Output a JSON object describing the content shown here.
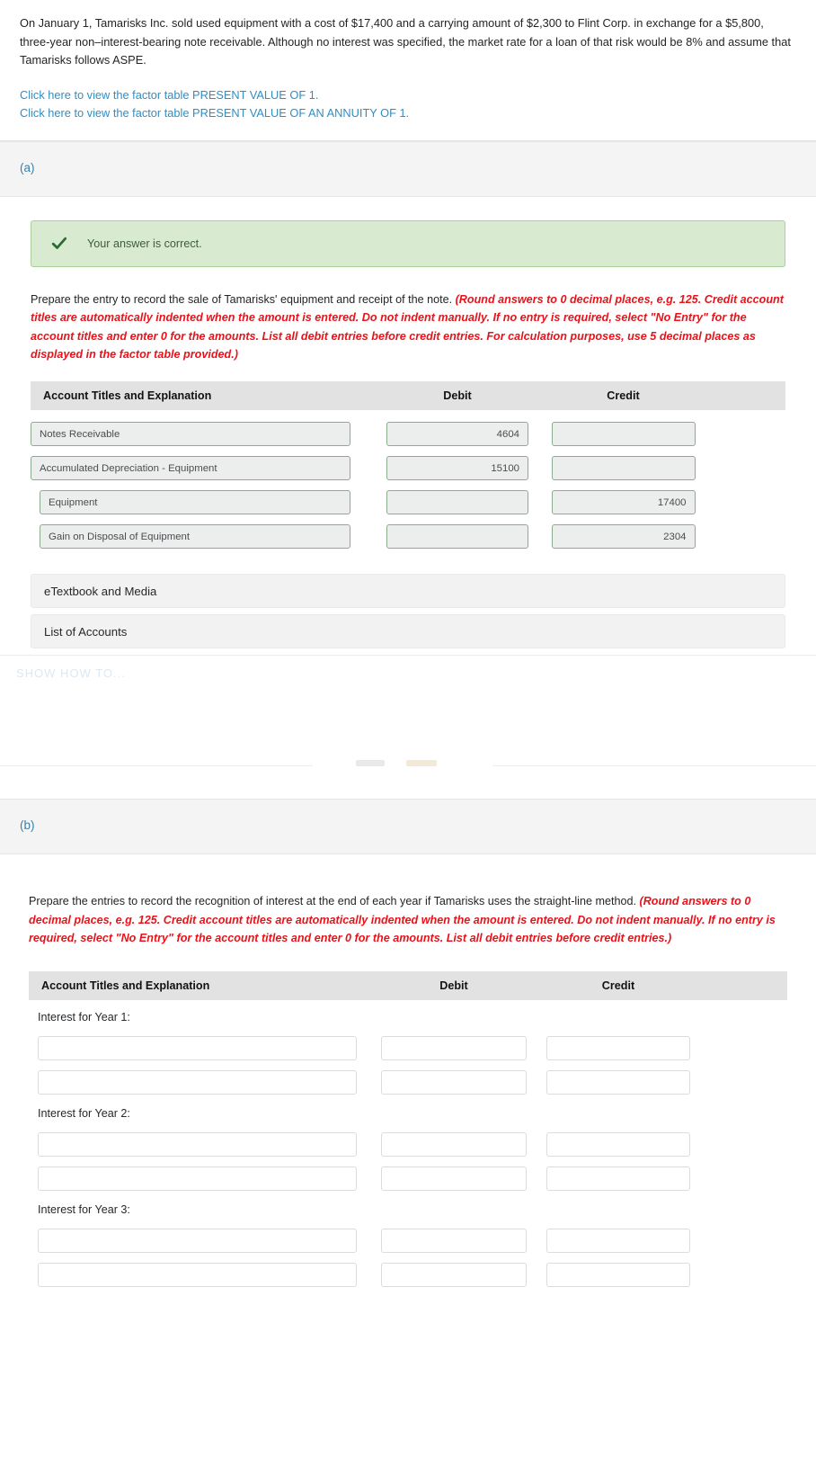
{
  "problem": {
    "statement": "On January 1, Tamarisks Inc. sold used equipment with a cost of $17,400 and a carrying amount of $2,300 to Flint Corp. in exchange for a $5,800, three-year non–interest-bearing note receivable. Although no interest was specified, the market rate for a loan of that risk would be 8% and assume that Tamarisks follows ASPE.",
    "links": [
      "Click here to view the factor table PRESENT VALUE OF 1.",
      "Click here to view the factor table PRESENT VALUE OF AN ANNUITY OF 1."
    ]
  },
  "colors": {
    "link": "#2f8ec4",
    "part_label": "#3a7fa8",
    "alert_bg": "#d8ebd0",
    "alert_border": "#a9cf9b",
    "alert_check": "#2b6b33",
    "instruction_emphasis": "#e8131a",
    "table_header_bg": "#e2e2e2",
    "answered_input_border": "#8aad8d",
    "answered_input_bg": "#eceded"
  },
  "part_a": {
    "label": "(a)",
    "alert": {
      "icon": "check-icon",
      "text": "Your answer is correct."
    },
    "instruction_plain": "Prepare the entry to record the sale of Tamarisks' equipment and receipt of the note. ",
    "instruction_emphasis": "(Round answers to 0 decimal places, e.g. 125. Credit account titles are automatically indented when the amount is entered. Do not indent manually. If no entry is required, select \"No Entry\" for the account titles and enter 0 for the amounts. List all debit entries before credit entries. For calculation purposes, use 5 decimal places as displayed in the factor table provided.)",
    "table": {
      "headers": {
        "account": "Account Titles and Explanation",
        "debit": "Debit",
        "credit": "Credit"
      },
      "rows": [
        {
          "account": "Notes Receivable",
          "debit": "4604",
          "credit": "",
          "indent": false
        },
        {
          "account": "Accumulated Depreciation - Equipment",
          "debit": "15100",
          "credit": "",
          "indent": false
        },
        {
          "account": "Equipment",
          "debit": "",
          "credit": "17400",
          "indent": true
        },
        {
          "account": "Gain on Disposal of Equipment",
          "debit": "",
          "credit": "2304",
          "indent": true
        }
      ]
    },
    "panels": [
      "eTextbook and Media",
      "List of Accounts"
    ]
  },
  "gap": {
    "ghost_text": "SHOW HOW TO..."
  },
  "part_b": {
    "label": "(b)",
    "instruction_plain": "Prepare the entries to record the recognition of interest at the end of each year if Tamarisks uses the straight-line method. ",
    "instruction_emphasis": "(Round answers to 0 decimal places, e.g. 125. Credit account titles are automatically indented when the amount is entered. Do not indent manually. If no entry is required, select \"No Entry\" for the account titles and enter 0 for the amounts. List all debit entries before credit entries.)",
    "table": {
      "headers": {
        "account": "Account Titles and Explanation",
        "debit": "Debit",
        "credit": "Credit"
      },
      "groups": [
        {
          "label": "Interest for Year 1:",
          "rows": [
            {
              "account": "",
              "debit": "",
              "credit": ""
            },
            {
              "account": "",
              "debit": "",
              "credit": ""
            }
          ]
        },
        {
          "label": "Interest for Year 2:",
          "rows": [
            {
              "account": "",
              "debit": "",
              "credit": ""
            },
            {
              "account": "",
              "debit": "",
              "credit": ""
            }
          ]
        },
        {
          "label": "Interest for Year 3:",
          "rows": [
            {
              "account": "",
              "debit": "",
              "credit": ""
            },
            {
              "account": "",
              "debit": "",
              "credit": ""
            }
          ]
        }
      ]
    }
  }
}
